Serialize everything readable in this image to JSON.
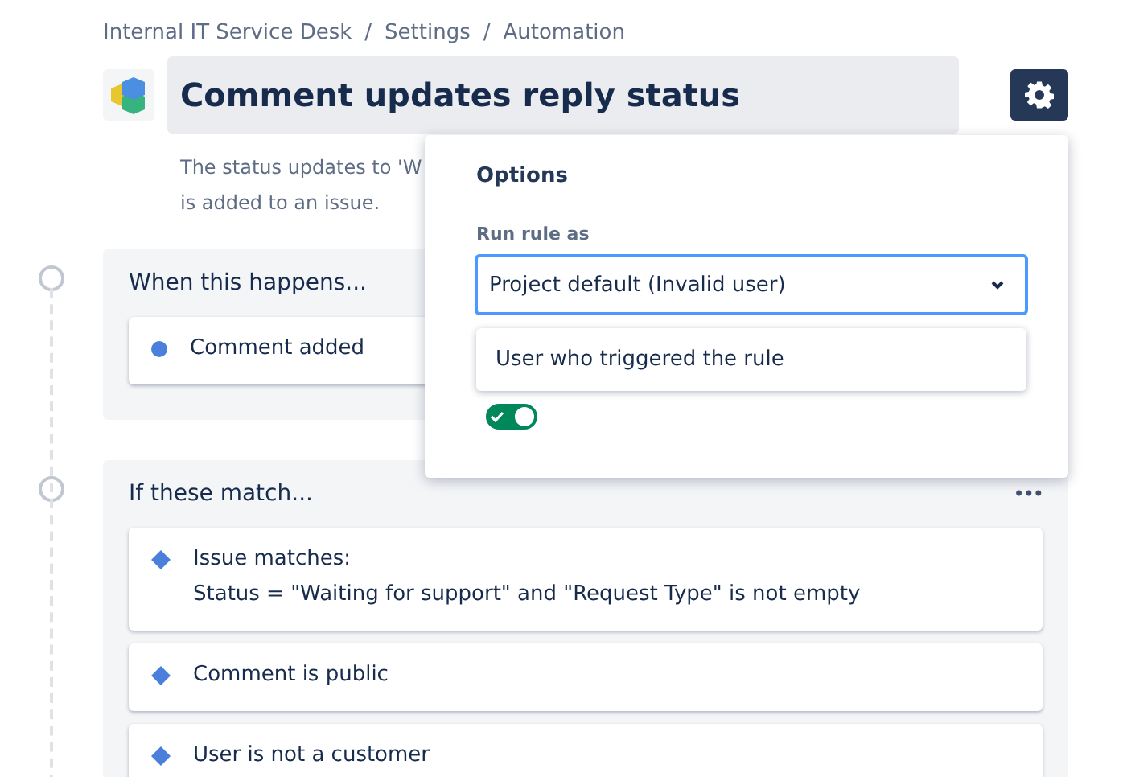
{
  "breadcrumbs": [
    {
      "label": "Internal IT Service Desk"
    },
    {
      "separator": "/",
      "label": "Settings"
    },
    {
      "separator": "/",
      "label": "Automation"
    }
  ],
  "rule": {
    "title": "Comment updates reply status",
    "description_lines": [
      "The status updates to 'W",
      "is added to an issue."
    ]
  },
  "sections": [
    {
      "title": "When this happens...",
      "items": [
        {
          "kind": "trigger",
          "lines": [
            "Comment added"
          ]
        }
      ]
    },
    {
      "title": "If these match...",
      "more": "•••",
      "items": [
        {
          "kind": "condition",
          "lines": [
            "Issue matches:",
            "Status = \"Waiting for support\" and \"Request Type\" is not empty"
          ]
        },
        {
          "kind": "condition",
          "lines": [
            "Comment is public"
          ]
        },
        {
          "kind": "condition",
          "lines": [
            "User is not a customer"
          ]
        }
      ]
    }
  ],
  "options_popover": {
    "title": "Options",
    "field_label": "Run rule as",
    "value": "Project default (Invalid user)",
    "expanded": true,
    "menu_options": [
      "User who triggered the rule"
    ],
    "toggle": {
      "on": true
    }
  }
}
